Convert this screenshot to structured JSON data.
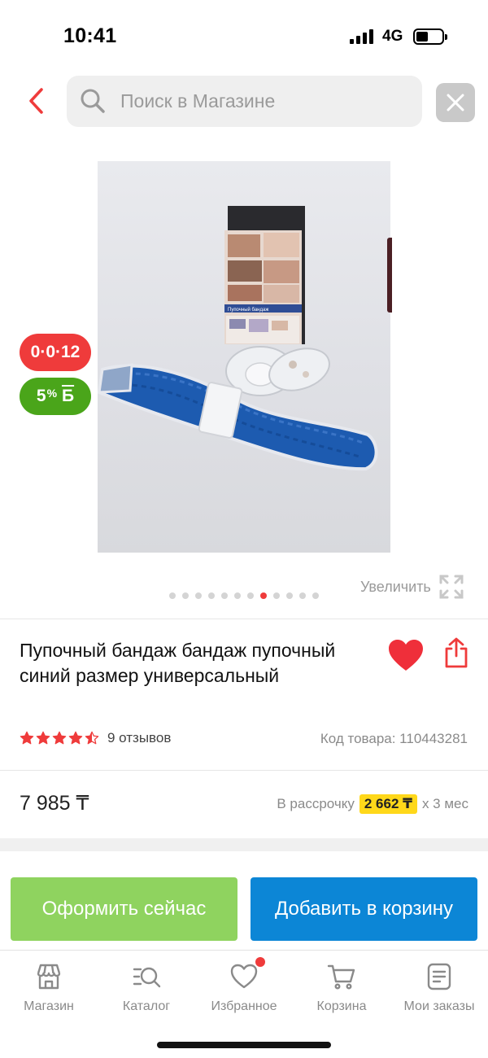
{
  "status": {
    "time": "10:41",
    "network": "4G"
  },
  "search": {
    "placeholder": "Поиск в Магазине"
  },
  "badges": {
    "installment": "0·0·12",
    "bonus_percent": "5",
    "bonus_symbol": "%",
    "bonus_currency": "Б"
  },
  "gallery": {
    "image_count": 12,
    "active_index": 7,
    "zoom_label": "Увеличить"
  },
  "product": {
    "title": "Пупочный бандаж бандаж пупочный синий размер универсальный",
    "rating": 4.5,
    "reviews": "9 отзывов",
    "sku": "Код товара: 110443281",
    "price": "7 985 ₸",
    "installment_prefix": "В рассрочку",
    "installment_amount": "2 662 ₸",
    "installment_suffix": "х 3 мес",
    "box_label": "Пупочный бандаж"
  },
  "actions": {
    "buy_now": "Оформить сейчас",
    "add_to_cart": "Добавить в корзину"
  },
  "tabbar": {
    "items": [
      {
        "label": "Магазин",
        "icon": "store-icon"
      },
      {
        "label": "Каталог",
        "icon": "catalog-icon"
      },
      {
        "label": "Избранное",
        "icon": "heart-outline-icon",
        "has_notification": true
      },
      {
        "label": "Корзина",
        "icon": "cart-icon"
      },
      {
        "label": "Мои заказы",
        "icon": "orders-icon"
      }
    ]
  },
  "colors": {
    "accent_red": "#ef3b3b",
    "buy_green": "#8fd35f",
    "cart_blue": "#0c86d6",
    "bonus_green": "#4aa51a",
    "installment_yellow": "#ffd81a"
  }
}
